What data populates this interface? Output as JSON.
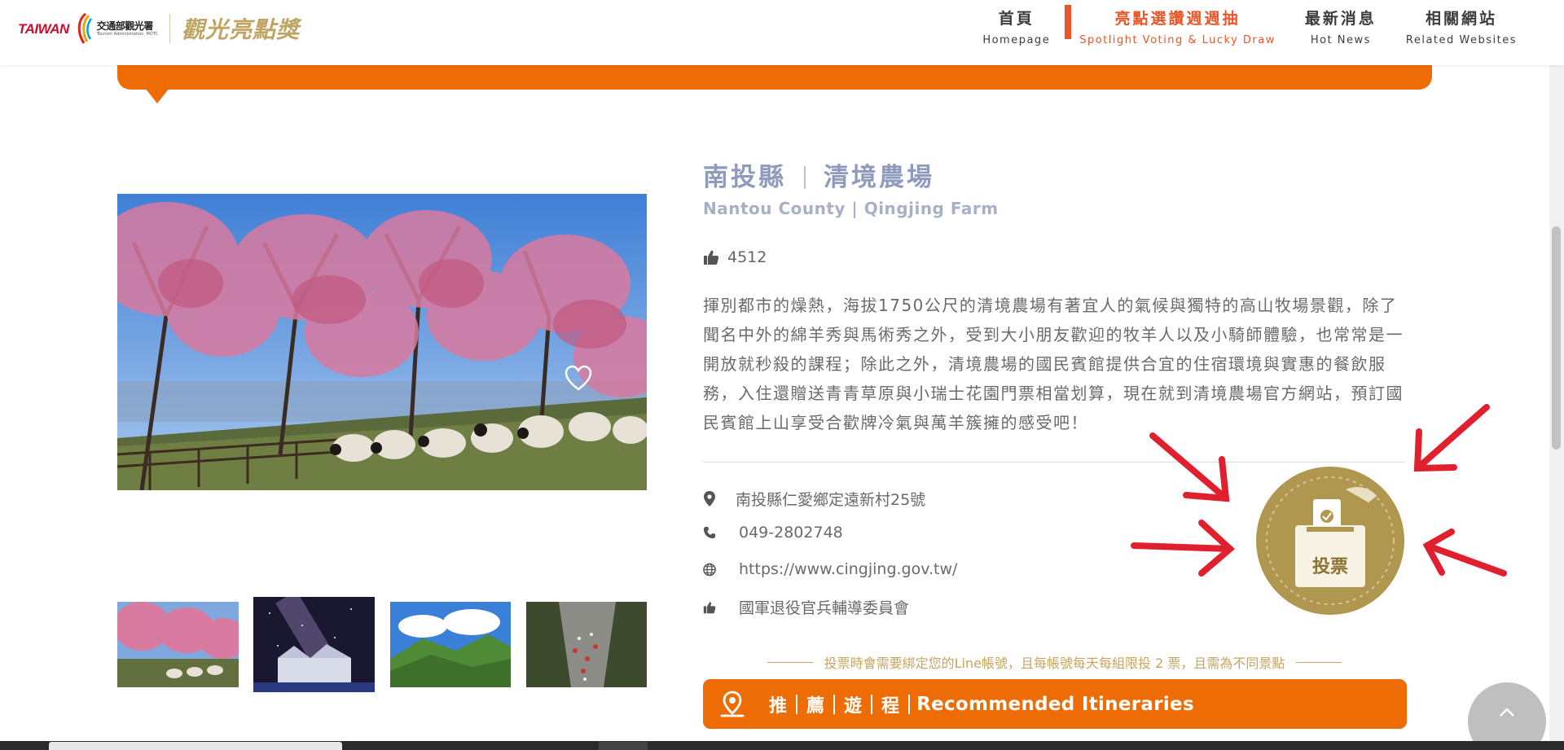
{
  "header": {
    "logo": {
      "taiwan": "TAIWAN",
      "ministry_cn": "交通部觀光署",
      "ministry_en": "Tourism Administration, MOTC",
      "award": "觀光亮點獎"
    },
    "nav": [
      {
        "cn": "首頁",
        "en": "Homepage",
        "active": false
      },
      {
        "cn": "亮點選讚週週抽",
        "en": "Spotlight Voting & Lucky Draw",
        "active": true
      },
      {
        "cn": "最新消息",
        "en": "Hot News",
        "active": false
      },
      {
        "cn": "相關網站",
        "en": "Related Websites",
        "active": false
      }
    ]
  },
  "spot": {
    "county_cn": "南投縣",
    "name_cn": "清境農場",
    "title_en": "Nantou County | Qingjing Farm",
    "likes": "4512",
    "description": "揮別都市的燥熱，海拔1750公尺的清境農場有著宜人的氣候與獨特的高山牧場景觀，除了聞名中外的綿羊秀與馬術秀之外，受到大小朋友歡迎的牧羊人以及小騎師體驗，也常常是一開放就秒殺的課程；除此之外，清境農場的國民賓館提供合宜的住宿環境與實惠的餐飲服務，入住還贈送青青草原與小瑞士花園門票相當划算，現在就到清境農場官方網站，預訂國民賓館上山享受合歡牌冷氣與萬羊簇擁的感受吧！",
    "address": "南投縣仁愛鄉定遠新村25號",
    "phone": "049-2802748",
    "website": "https://www.cingjing.gov.tw/",
    "organizer": "國軍退役官兵輔導委員會"
  },
  "vote": {
    "label": "投票",
    "notice": "投票時會需要綁定您的Line帳號，且每帳號每天每組限投 2 票，且需為不同景點"
  },
  "itinerary": {
    "chars": [
      "推",
      "薦",
      "遊",
      "程"
    ],
    "label_en": "Recommended Itineraries"
  },
  "icons": {
    "likes": "thumbs-up-icon",
    "address": "map-marker-icon",
    "phone": "phone-icon",
    "website": "globe-icon",
    "organizer": "thumbs-up-icon",
    "favorite": "heart-icon",
    "scroll_top": "chevron-up-icon",
    "itinerary": "location-pin-icon"
  },
  "colors": {
    "accent": "#ee6c06",
    "active_nav": "#e8562a",
    "title": "#8e9bbd",
    "gold": "#bfa463",
    "arrow_red": "#e0202e"
  }
}
